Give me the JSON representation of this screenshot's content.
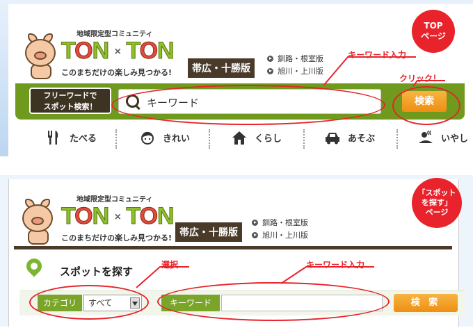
{
  "top_page": {
    "badge": [
      "TOP",
      "ページ"
    ],
    "logo": {
      "subtitle": "地域限定型コミュニティ",
      "word_left": "T",
      "word_left_o": "O",
      "word_left_n": "N",
      "separator": "×",
      "word_right": "T",
      "word_right_o": "O",
      "word_right_n": "N",
      "tagline": "このまちだけの楽しみ見つかる!"
    },
    "region": "帯広・十勝版",
    "cities": [
      "釧路・根室版",
      "旭川・上川版"
    ],
    "search": {
      "label_line1": "フリーワードで",
      "label_line2": "スポット検索！",
      "value": "キーワード",
      "button": "検索"
    },
    "nav": [
      {
        "label": "たべる",
        "icon": "fork-knife-icon"
      },
      {
        "label": "きれい",
        "icon": "face-icon"
      },
      {
        "label": "くらし",
        "icon": "house-icon"
      },
      {
        "label": "あそぶ",
        "icon": "car-icon"
      },
      {
        "label": "いやし",
        "icon": "onsen-icon"
      }
    ],
    "annotations": {
      "keyword": "キーワード入力",
      "click": "クリック！"
    }
  },
  "spot_page": {
    "badge": [
      "「スポット",
      "を探す」",
      "ページ"
    ],
    "title": "スポットを探す",
    "category_label": "カテゴリ",
    "category_value": "すべて",
    "keyword_label": "キーワード",
    "button": "検 索",
    "annotations": {
      "select": "選択",
      "keyword": "キーワード入力"
    }
  },
  "colors": {
    "accent_green": "#6f9a1e",
    "annotation_red": "#e8232b",
    "button_orange": "#ee8f12",
    "brown": "#3d3323"
  }
}
